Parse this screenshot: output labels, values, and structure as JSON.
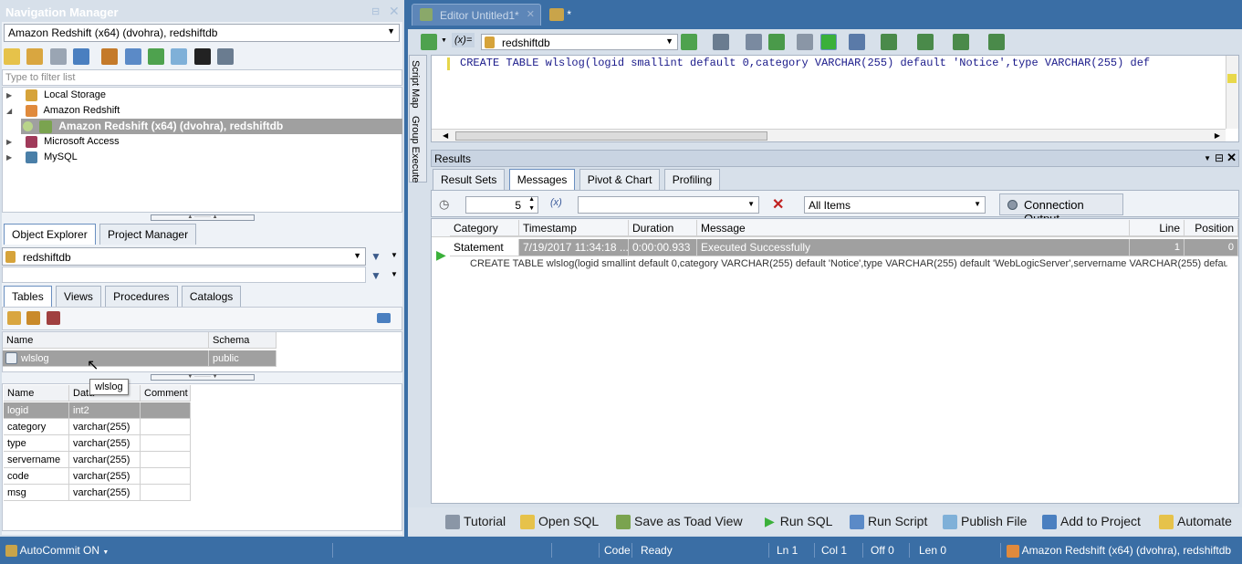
{
  "nav_manager": {
    "title": "Navigation Manager",
    "connection_select": "Amazon Redshift (x64) (dvohra), redshiftdb",
    "filter_placeholder": "Type to filter list",
    "tree": [
      {
        "label": "Local Storage"
      },
      {
        "label": "Amazon Redshift"
      },
      {
        "label": "Amazon Redshift (x64) (dvohra), redshiftdb"
      },
      {
        "label": "Microsoft Access"
      },
      {
        "label": "MySQL"
      }
    ]
  },
  "explorer": {
    "tabs": [
      "Object Explorer",
      "Project Manager"
    ],
    "db_select": "redshiftdb",
    "object_tabs": [
      "Tables",
      "Views",
      "Procedures",
      "Catalogs"
    ],
    "table_headers": [
      "Name",
      "Schema"
    ],
    "table_rows": [
      {
        "name": "wlslog",
        "schema": "public"
      }
    ],
    "tooltip": "wlslog",
    "column_headers": [
      "Name",
      "Data",
      "Comment"
    ],
    "columns": [
      {
        "name": "logid",
        "type": "int2"
      },
      {
        "name": "category",
        "type": "varchar(255)"
      },
      {
        "name": "type",
        "type": "varchar(255)"
      },
      {
        "name": "servername",
        "type": "varchar(255)"
      },
      {
        "name": "code",
        "type": "varchar(255)"
      },
      {
        "name": "msg",
        "type": "varchar(255)"
      }
    ]
  },
  "editor": {
    "tabs": [
      "Editor Untitled1*",
      "*"
    ],
    "db_select": "redshiftdb",
    "side_tabs": [
      "Script Map",
      "Group Execute"
    ],
    "sql_text": "CREATE TABLE wlslog(logid smallint default 0,category VARCHAR(255) default 'Notice',type VARCHAR(255) def"
  },
  "results": {
    "title": "Results",
    "tabs": [
      "Result Sets",
      "Messages",
      "Pivot & Chart",
      "Profiling"
    ],
    "spin_value": "5",
    "filter_select": "All Items",
    "connection_output": "Connection Output",
    "headers": [
      "Category",
      "Timestamp",
      "Duration",
      "Message",
      "Line",
      "Position"
    ],
    "row": {
      "category": "Statement",
      "timestamp": "7/19/2017 11:34:18 ...",
      "duration": "0:00:00.933",
      "message": "Executed Successfully",
      "line": "1",
      "position": "0"
    },
    "detail": "CREATE TABLE wlslog(logid smallint default 0,category VARCHAR(255) default 'Notice',type VARCHAR(255) default 'WebLogicServer',servername VARCHAR(255) default..."
  },
  "bottom_bar": [
    "Tutorial",
    "Open SQL",
    "Save as Toad View",
    "Run SQL",
    "Run Script",
    "Publish File",
    "Add to Project",
    "Automate"
  ],
  "status_bar": {
    "autocommit": "AutoCommit ON",
    "code": "Code",
    "ready": "Ready",
    "ln": "Ln 1",
    "col": "Col 1",
    "off": "Off 0",
    "len": "Len 0",
    "connection": "Amazon Redshift (x64) (dvohra), redshiftdb"
  }
}
